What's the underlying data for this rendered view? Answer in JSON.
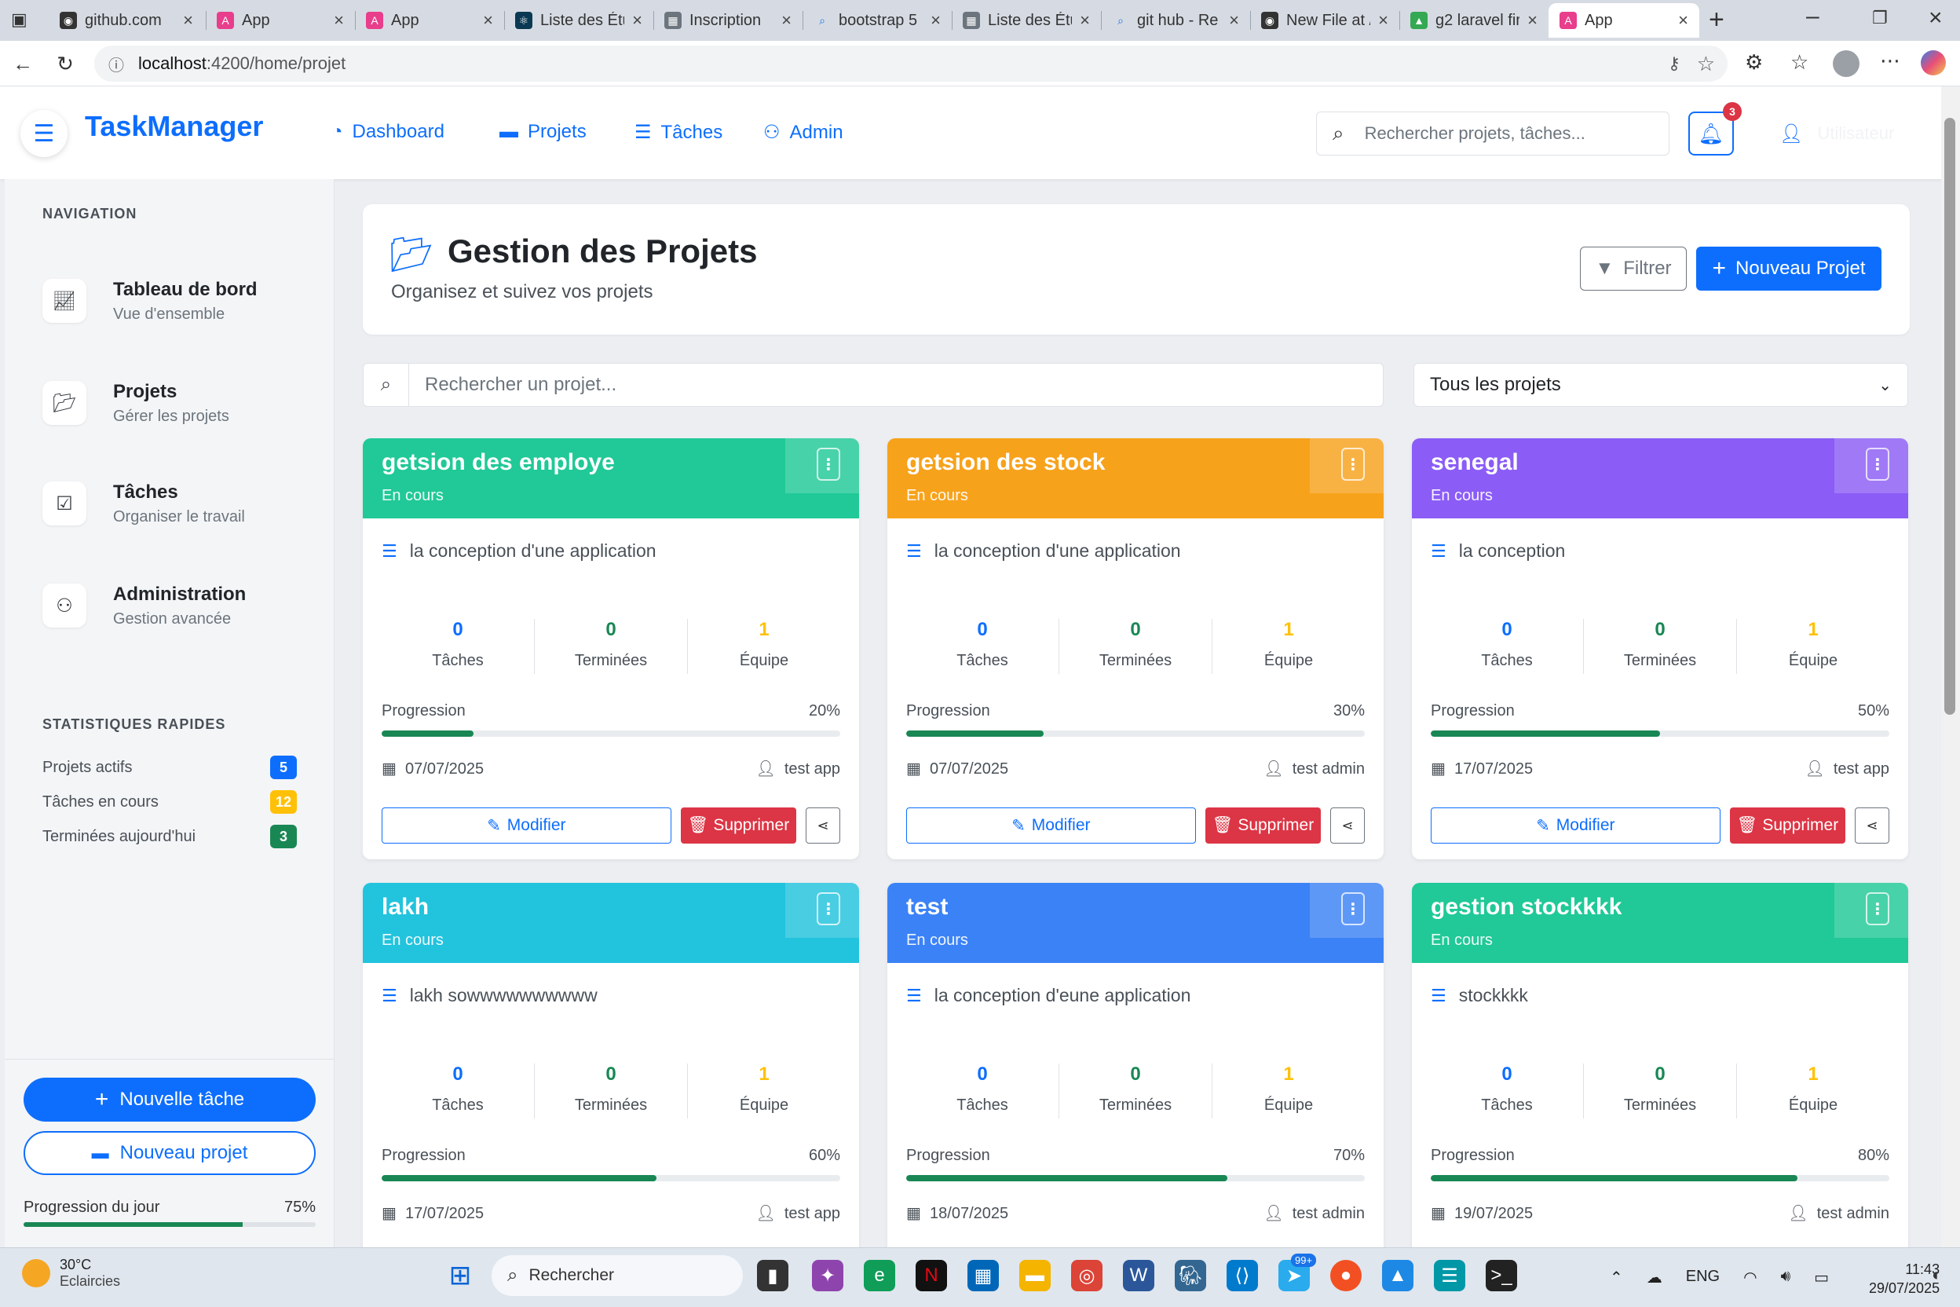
{
  "browser": {
    "tabs": [
      {
        "label": "github.com"
      },
      {
        "label": "App"
      },
      {
        "label": "App"
      },
      {
        "label": "Liste des Étu"
      },
      {
        "label": "Inscription"
      },
      {
        "label": "bootstrap 5"
      },
      {
        "label": "Liste des Étu"
      },
      {
        "label": "git hub - Re"
      },
      {
        "label": "New File at /"
      },
      {
        "label": "g2 laravel fir"
      },
      {
        "label": "App"
      }
    ],
    "url_host": "localhost",
    "url_path": ":4200/home/projet"
  },
  "topnav": {
    "brand": "TaskManager",
    "links": [
      {
        "label": "Dashboard",
        "icon": "chart-pie-icon"
      },
      {
        "label": "Projets",
        "icon": "folder-icon"
      },
      {
        "label": "Tâches",
        "icon": "list-check-icon"
      },
      {
        "label": "Admin",
        "icon": "users-cog-icon"
      }
    ],
    "search_placeholder": "Rechercher projets, tâches...",
    "notif_count": "3",
    "user_label": "Utilisateur"
  },
  "sidebar": {
    "nav_heading": "NAVIGATION",
    "items": [
      {
        "title": "Tableau de bord",
        "subtitle": "Vue d'ensemble",
        "icon": "chart-line-icon"
      },
      {
        "title": "Projets",
        "subtitle": "Gérer les projets",
        "icon": "folder-open-icon"
      },
      {
        "title": "Tâches",
        "subtitle": "Organiser le travail",
        "icon": "square-check-icon"
      },
      {
        "title": "Administration",
        "subtitle": "Gestion avancée",
        "icon": "users-cog-icon"
      }
    ],
    "stats_heading": "STATISTIQUES RAPIDES",
    "stats": [
      {
        "label": "Projets actifs",
        "value": "5",
        "color": "#0d6efd"
      },
      {
        "label": "Tâches en cours",
        "value": "12",
        "color": "#ffc107"
      },
      {
        "label": "Terminées aujourd'hui",
        "value": "3",
        "color": "#198754"
      }
    ],
    "new_task_label": "Nouvelle tâche",
    "new_project_label": "Nouveau projet",
    "day_progress_label": "Progression du jour",
    "day_progress_value": "75%",
    "day_progress_fraction": 0.75
  },
  "page": {
    "title": "Gestion des Projets",
    "subtitle": "Organisez et suivez vos projets",
    "filter_label": "Filtrer",
    "new_project_label": "Nouveau Projet",
    "search_placeholder": "Rechercher un projet...",
    "filter_select_value": "Tous les projets"
  },
  "card_labels": {
    "tasks": "Tâches",
    "done": "Terminées",
    "team": "Équipe",
    "progress": "Progression",
    "edit": "Modifier",
    "delete": "Supprimer"
  },
  "projects": [
    {
      "name": "getsion des employe",
      "status": "En cours",
      "description": "la conception d'une application",
      "tasks": "0",
      "done": "0",
      "team": "1",
      "progress": "20%",
      "progress_fraction": 0.2,
      "date": "07/07/2025",
      "owner": "test app",
      "color": "#20c997"
    },
    {
      "name": "getsion des stock",
      "status": "En cours",
      "description": "la conception d'une application",
      "tasks": "0",
      "done": "0",
      "team": "1",
      "progress": "30%",
      "progress_fraction": 0.3,
      "date": "07/07/2025",
      "owner": "test admin",
      "color": "#f7a21b"
    },
    {
      "name": "senegal",
      "status": "En cours",
      "description": "la conception",
      "tasks": "0",
      "done": "0",
      "team": "1",
      "progress": "50%",
      "progress_fraction": 0.5,
      "date": "17/07/2025",
      "owner": "test app",
      "color": "#8b5cf6"
    },
    {
      "name": "lakh",
      "status": "En cours",
      "description": "lakh sowwwwwwwwww",
      "tasks": "0",
      "done": "0",
      "team": "1",
      "progress": "60%",
      "progress_fraction": 0.6,
      "date": "17/07/2025",
      "owner": "test app",
      "color": "#22c3dd"
    },
    {
      "name": "test",
      "status": "En cours",
      "description": "la conception d'eune application",
      "tasks": "0",
      "done": "0",
      "team": "1",
      "progress": "70%",
      "progress_fraction": 0.7,
      "date": "18/07/2025",
      "owner": "test admin",
      "color": "#3b82f6"
    },
    {
      "name": "gestion stockkkk",
      "status": "En cours",
      "description": "stockkkk",
      "tasks": "0",
      "done": "0",
      "team": "1",
      "progress": "80%",
      "progress_fraction": 0.8,
      "date": "19/07/2025",
      "owner": "test admin",
      "color": "#20c997"
    }
  ],
  "taskbar": {
    "weather_temp": "30°C",
    "weather_desc": "Eclaircies",
    "search_label": "Rechercher",
    "lang": "ENG",
    "time": "11:43",
    "date": "29/07/2025",
    "badge": "99+"
  }
}
